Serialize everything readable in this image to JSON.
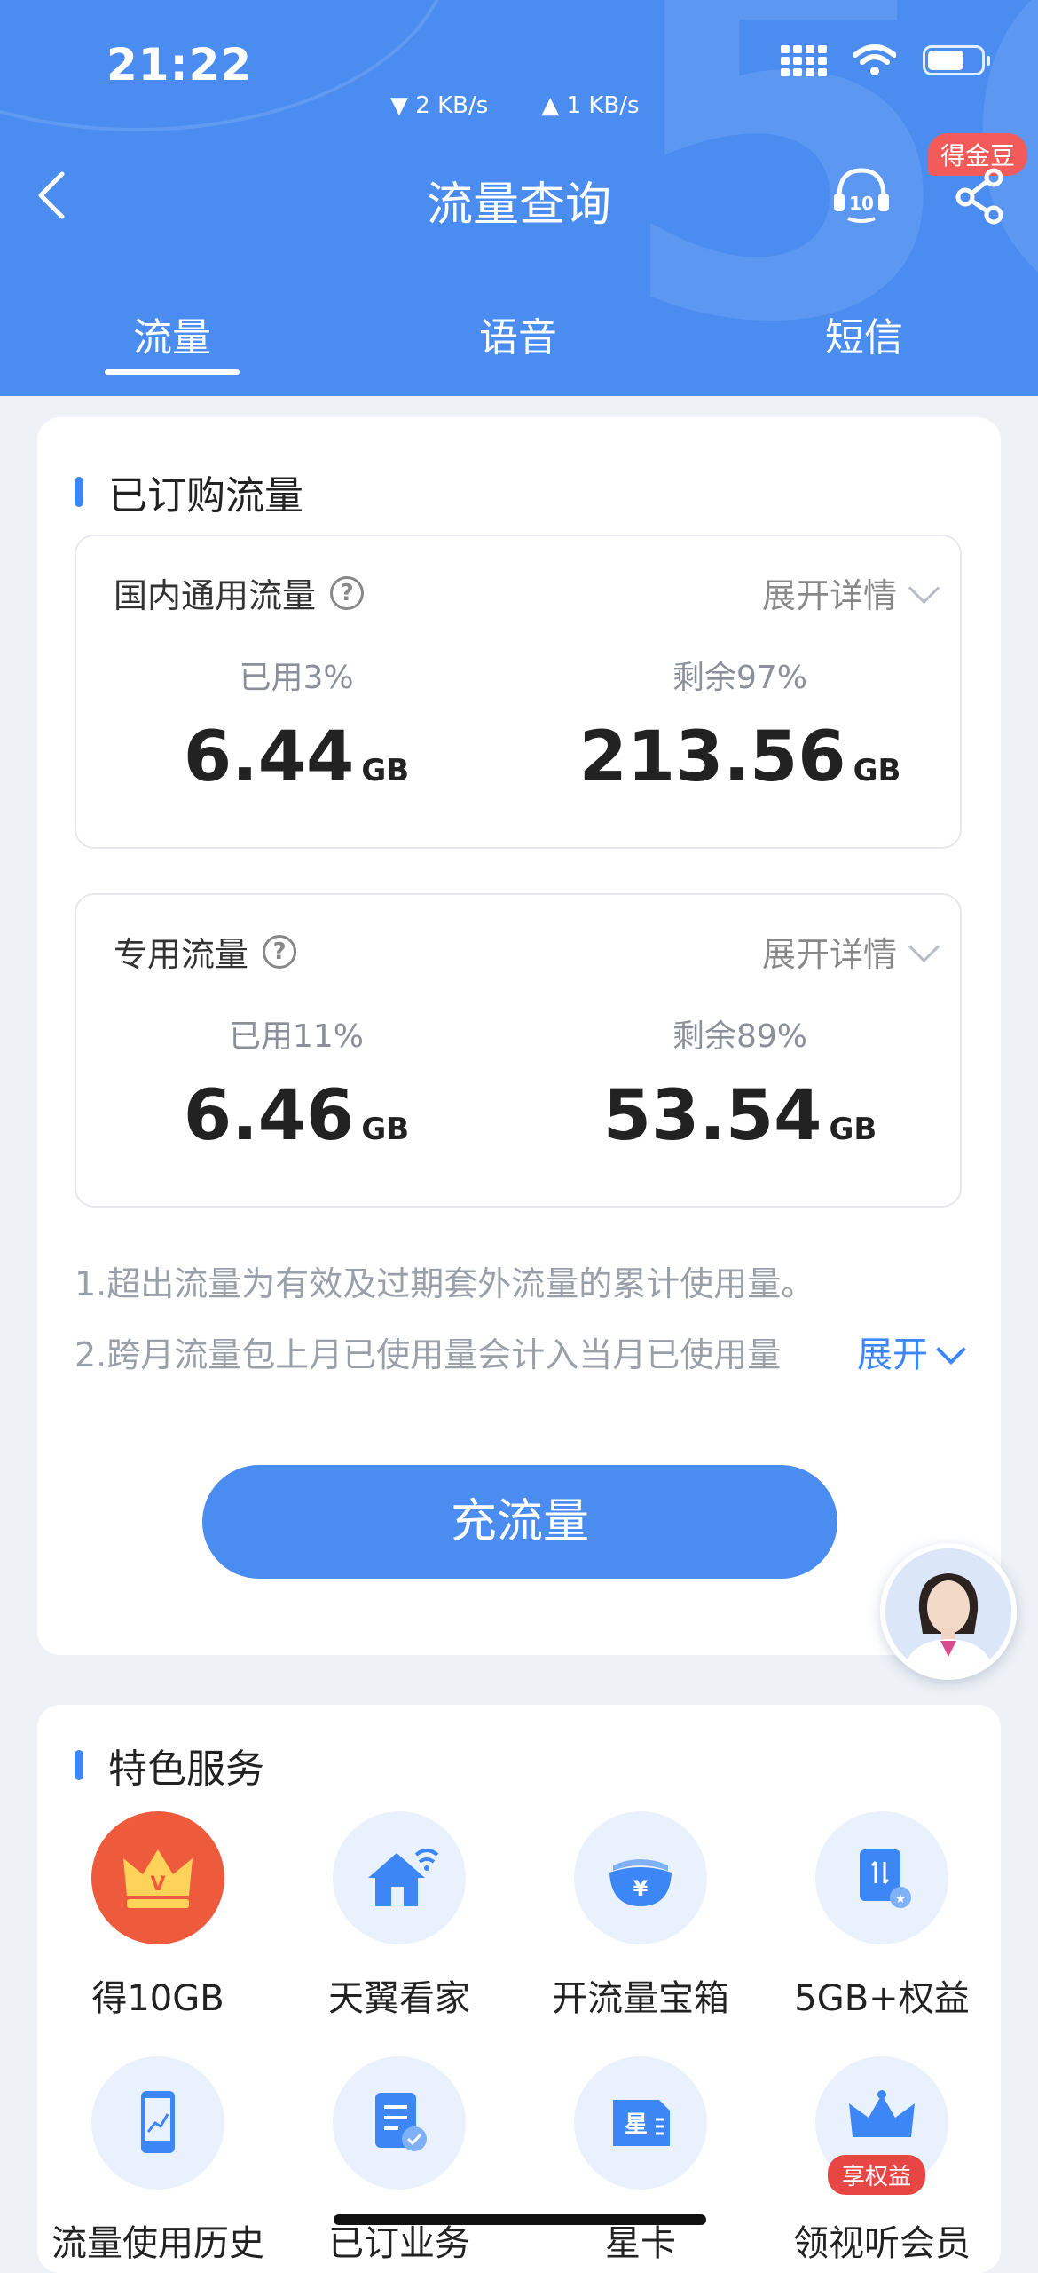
{
  "status_bar": {
    "time": "21:22",
    "down_speed": "▼ 2 KB/s",
    "up_speed": "▲ 1 KB/s"
  },
  "header": {
    "title": "流量查询",
    "badge": "得金豆",
    "tabs": [
      {
        "label": "流量",
        "active": true
      },
      {
        "label": "语音",
        "active": false
      },
      {
        "label": "短信",
        "active": false
      }
    ]
  },
  "subscribed": {
    "section_title": "已订购流量",
    "expand_label": "展开详情",
    "unit": "GB",
    "packages": [
      {
        "name": "国内通用流量",
        "used_label": "已用3%",
        "used": "6.44",
        "remaining_label": "剩余97%",
        "remaining": "213.56"
      },
      {
        "name": "专用流量",
        "used_label": "已用11%",
        "used": "6.46",
        "remaining_label": "剩余89%",
        "remaining": "53.54"
      }
    ],
    "notes": [
      "1.超出流量为有效及过期套外流量的累计使用量。",
      "2.跨月流量包上月已使用量会计入当月已使用量"
    ],
    "notes_expand": "展开",
    "recharge_button": "充流量"
  },
  "services": {
    "section_title": "特色服务",
    "items": [
      {
        "label": "得10GB",
        "icon": "crown-icon"
      },
      {
        "label": "天翼看家",
        "icon": "home-wifi-icon"
      },
      {
        "label": "开流量宝箱",
        "icon": "treasure-box-icon"
      },
      {
        "label": "5GB+权益",
        "icon": "data-card-icon"
      },
      {
        "label": "流量使用历史",
        "icon": "phone-chart-icon"
      },
      {
        "label": "已订业务",
        "icon": "document-check-icon"
      },
      {
        "label": "星卡",
        "icon": "sim-card-icon"
      },
      {
        "label": "领视听会员",
        "icon": "crown-member-icon",
        "tag": "享权益"
      }
    ]
  },
  "colors": {
    "primary": "#4a8cf0",
    "accent_blue": "#3c87f5",
    "badge_red": "#f35a5a"
  }
}
